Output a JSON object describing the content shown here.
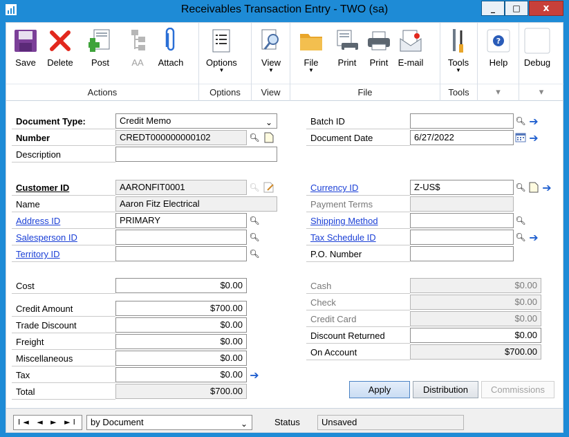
{
  "window": {
    "title": "Receivables Transaction Entry  -  TWO (sa)",
    "controls": [
      "_",
      "□",
      "x"
    ]
  },
  "ribbon": {
    "groups": [
      {
        "name": "Actions",
        "buttons": [
          {
            "label": "Save",
            "icon": "save-icon"
          },
          {
            "label": "Delete",
            "icon": "delete-icon"
          },
          {
            "label": "Post",
            "icon": "post-icon"
          },
          {
            "label": "AA",
            "icon": "aa-icon",
            "disabled": true
          },
          {
            "label": "Attach",
            "icon": "paperclip-icon"
          }
        ]
      },
      {
        "name": "Options",
        "buttons": [
          {
            "label": "Options",
            "icon": "options-icon",
            "dropdown": true
          }
        ]
      },
      {
        "name": "View",
        "buttons": [
          {
            "label": "View",
            "icon": "view-icon",
            "dropdown": true
          }
        ]
      },
      {
        "name": "File",
        "buttons": [
          {
            "label": "File",
            "icon": "folder-icon",
            "dropdown": true
          },
          {
            "label": "Print",
            "icon": "print-preview-icon"
          },
          {
            "label": "Print",
            "icon": "printer-icon"
          },
          {
            "label": "E-mail",
            "icon": "email-icon"
          }
        ]
      },
      {
        "name": "Tools",
        "buttons": [
          {
            "label": "Tools",
            "icon": "tools-icon",
            "dropdown": true
          }
        ]
      },
      {
        "name": "",
        "buttons": [
          {
            "label": "Help",
            "icon": "help-icon",
            "dropdown": false
          }
        ]
      },
      {
        "name": "",
        "buttons": [
          {
            "label": "Debug",
            "icon": "debug-icon",
            "dropdown": false
          }
        ]
      }
    ],
    "group_dropdown_mark": "▾"
  },
  "form": {
    "document_type": {
      "label": "Document Type:",
      "value": "Credit Memo"
    },
    "number": {
      "label": "Number",
      "value": "CREDT000000000102"
    },
    "description": {
      "label": "Description",
      "value": ""
    },
    "customer_id": {
      "label": "Customer ID",
      "value": "AARONFIT0001"
    },
    "name": {
      "label": "Name",
      "value": "Aaron Fitz Electrical"
    },
    "address_id": {
      "label": "Address ID",
      "value": "PRIMARY"
    },
    "salesperson_id": {
      "label": "Salesperson ID",
      "value": ""
    },
    "territory_id": {
      "label": "Territory ID",
      "value": ""
    },
    "batch_id": {
      "label": "Batch ID",
      "value": ""
    },
    "document_date": {
      "label": "Document Date",
      "value": "6/27/2022"
    },
    "currency_id": {
      "label": "Currency ID",
      "value": "Z-US$"
    },
    "payment_terms": {
      "label": "Payment Terms",
      "value": ""
    },
    "shipping_method": {
      "label": "Shipping Method",
      "value": ""
    },
    "tax_schedule_id": {
      "label": "Tax Schedule ID",
      "value": ""
    },
    "po_number": {
      "label": "P.O. Number",
      "value": ""
    }
  },
  "amounts": {
    "cost": {
      "label": "Cost",
      "value": "$0.00"
    },
    "credit_amount": {
      "label": "Credit Amount",
      "value": "$700.00"
    },
    "trade_discount": {
      "label": "Trade Discount",
      "value": "$0.00"
    },
    "freight": {
      "label": "Freight",
      "value": "$0.00"
    },
    "miscellaneous": {
      "label": "Miscellaneous",
      "value": "$0.00"
    },
    "tax": {
      "label": "Tax",
      "value": "$0.00"
    },
    "total": {
      "label": "Total",
      "value": "$700.00"
    },
    "cash": {
      "label": "Cash",
      "value": "$0.00"
    },
    "check": {
      "label": "Check",
      "value": "$0.00"
    },
    "credit_card": {
      "label": "Credit Card",
      "value": "$0.00"
    },
    "discount_returned": {
      "label": "Discount Returned",
      "value": "$0.00"
    },
    "on_account": {
      "label": "On Account",
      "value": "$700.00"
    }
  },
  "buttons": {
    "apply": "Apply",
    "distribution": "Distribution",
    "commissions": "Commissions"
  },
  "statusbar": {
    "nav": "I◄ ◄ ► ►I",
    "sort": "by Document",
    "status_label": "Status",
    "status_value": "Unsaved"
  }
}
